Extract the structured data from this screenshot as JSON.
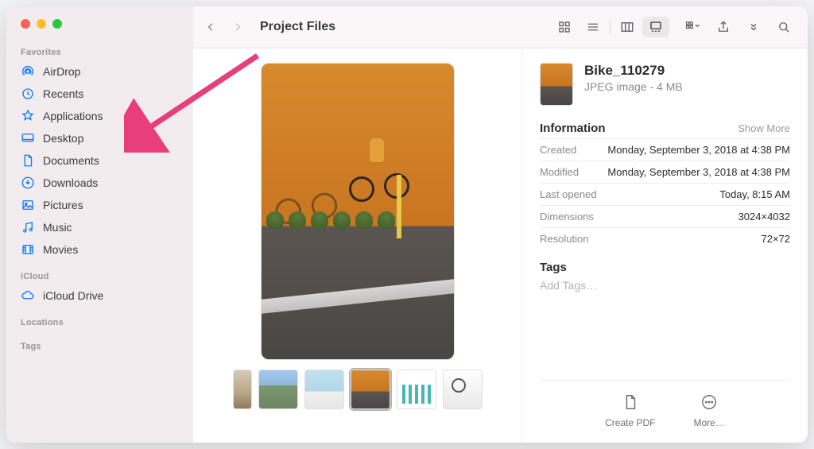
{
  "window": {
    "title": "Project Files"
  },
  "sidebar": {
    "sections": [
      {
        "title": "Favorites",
        "items": [
          {
            "label": "AirDrop",
            "icon": "airdrop"
          },
          {
            "label": "Recents",
            "icon": "clock"
          },
          {
            "label": "Applications",
            "icon": "apps"
          },
          {
            "label": "Desktop",
            "icon": "desktop"
          },
          {
            "label": "Documents",
            "icon": "document"
          },
          {
            "label": "Downloads",
            "icon": "download"
          },
          {
            "label": "Pictures",
            "icon": "pictures"
          },
          {
            "label": "Music",
            "icon": "music"
          },
          {
            "label": "Movies",
            "icon": "movies"
          }
        ]
      },
      {
        "title": "iCloud",
        "items": [
          {
            "label": "iCloud Drive",
            "icon": "cloud"
          }
        ]
      },
      {
        "title": "Locations",
        "items": []
      },
      {
        "title": "Tags",
        "items": []
      }
    ]
  },
  "file": {
    "name": "Bike_110279",
    "kind": "JPEG image - 4 MB"
  },
  "info": {
    "section_title": "Information",
    "show_more": "Show More",
    "rows": [
      {
        "k": "Created",
        "v": "Monday, September 3, 2018 at 4:38 PM"
      },
      {
        "k": "Modified",
        "v": "Monday, September 3, 2018 at 4:38 PM"
      },
      {
        "k": "Last opened",
        "v": "Today, 8:15 AM"
      },
      {
        "k": "Dimensions",
        "v": "3024×4032"
      },
      {
        "k": "Resolution",
        "v": "72×72"
      }
    ],
    "tags_title": "Tags",
    "add_tags": "Add Tags…"
  },
  "actions": {
    "create_pdf": "Create PDF",
    "more": "More…"
  },
  "annotation": {
    "arrow_color": "#e83e7a"
  }
}
